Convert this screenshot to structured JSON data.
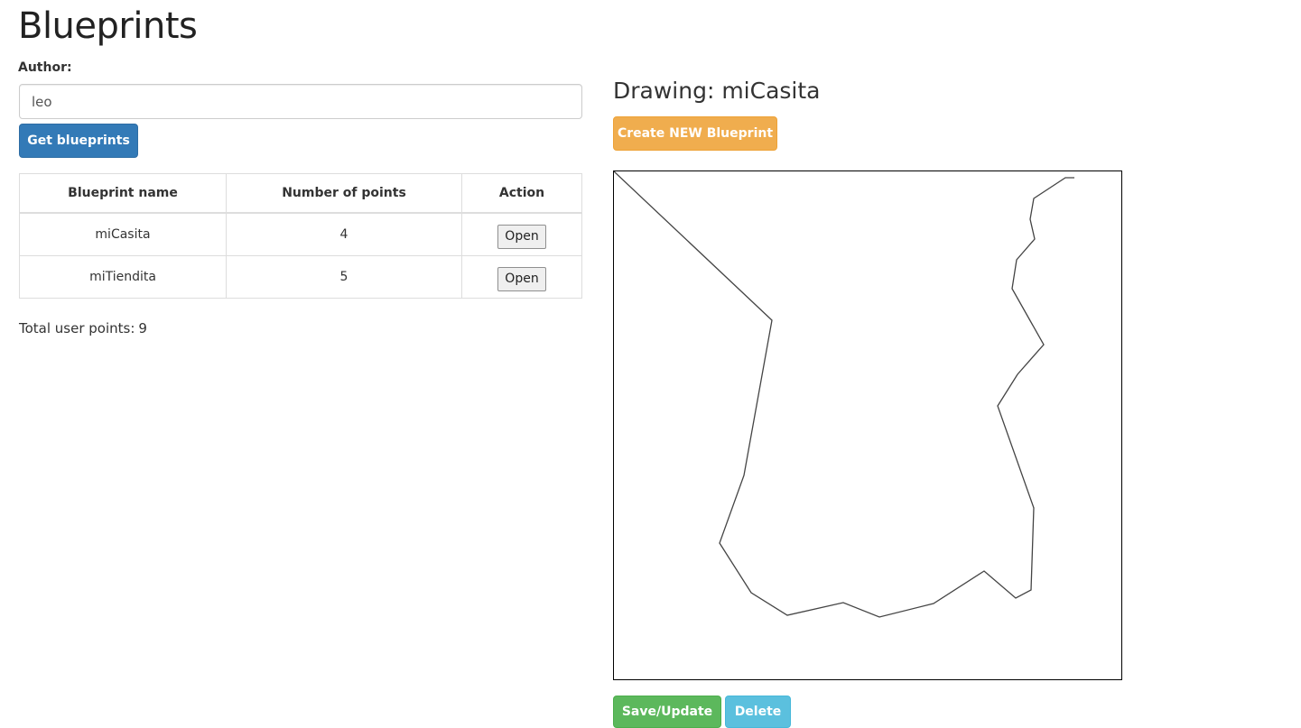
{
  "app": {
    "title": "Blueprints"
  },
  "author": {
    "label": "Author:",
    "value": "leo"
  },
  "buttons": {
    "get_blueprints": "Get blueprints",
    "create_new": "Create NEW Blueprint",
    "save_update": "Save/Update",
    "delete": "Delete"
  },
  "table": {
    "headers": [
      "Blueprint name",
      "Number of points",
      "Action"
    ],
    "rows": [
      {
        "name": "miCasita",
        "points": "4",
        "action": "Open"
      },
      {
        "name": "miTiendita",
        "points": "5",
        "action": "Open"
      }
    ]
  },
  "total": {
    "label": "Total user points:",
    "value": "9"
  },
  "drawing": {
    "title": "Drawing: miCasita"
  },
  "colors": {
    "primary": "#337ab7",
    "warning": "#f0ad4e",
    "success": "#5cb85c",
    "info": "#5bc0de",
    "stroke": "#444444"
  }
}
